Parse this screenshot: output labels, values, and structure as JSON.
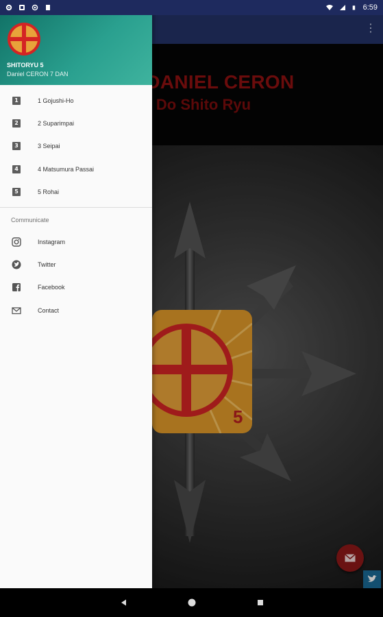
{
  "status_bar": {
    "time": "6:59"
  },
  "banner": {
    "title": "nseï DANIEL CERON",
    "subtitle": "até Do Shito Ryu"
  },
  "drawer": {
    "app_name": "SHITORYU 5",
    "app_subtitle": "Daniel CERON 7 DAN",
    "kata_items": [
      {
        "icon": "1",
        "label": "1 Gojushi-Ho"
      },
      {
        "icon": "2",
        "label": "2 Suparimpai"
      },
      {
        "icon": "3",
        "label": "3 Seipai"
      },
      {
        "icon": "4",
        "label": "4 Matsumura Passai"
      },
      {
        "icon": "5",
        "label": "5 Rohai"
      }
    ],
    "section_title": "Communicate",
    "communicate_items": [
      {
        "icon": "instagram-icon",
        "label": "Instagram"
      },
      {
        "icon": "twitter-icon",
        "label": "Twitter"
      },
      {
        "icon": "facebook-icon",
        "label": "Facebook"
      },
      {
        "icon": "email-icon",
        "label": "Contact"
      }
    ]
  },
  "colors": {
    "toolbar": "#233266",
    "drawer_header": "#2aa08f",
    "banner_text": "#8e1010",
    "fab": "#8e1818",
    "logo_sun": "#e09a2a",
    "logo_red": "#d42424"
  }
}
